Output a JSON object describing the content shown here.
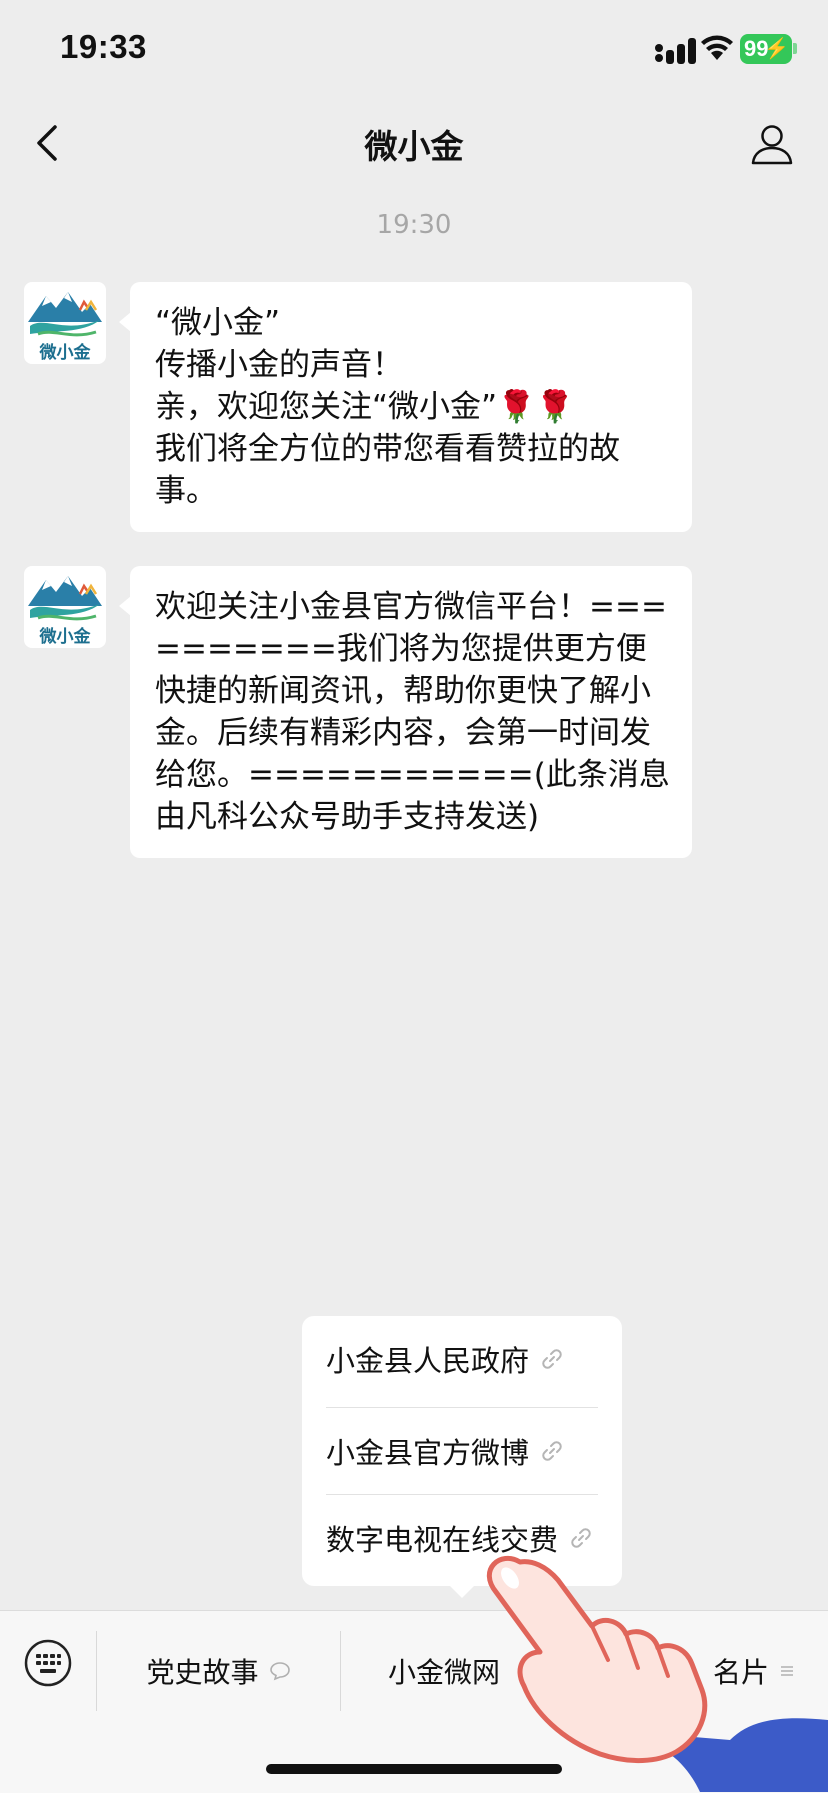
{
  "status_bar": {
    "time": "19:33",
    "battery": "99"
  },
  "nav": {
    "title": "微小金"
  },
  "chat": {
    "timestamp": "19:30",
    "messages": [
      {
        "avatar_caption": "微小金",
        "text": "“微小金”\n传播小金的声音！\n亲，欢迎您关注“微小金”🌹🌹\n我们将全方位的带您看看赞拉的故事。"
      },
      {
        "avatar_caption": "微小金",
        "text": "欢迎关注小金县官方微信平台！==========我们将为您提供更方便快捷的新闻资讯，帮助你更快了解小金。后续有精彩内容，会第一时间发给您。===========(此条消息由凡科公众号助手支持发送)"
      }
    ]
  },
  "popup_menu": {
    "items": [
      {
        "label": "小金县人民政府",
        "icon": "link-icon"
      },
      {
        "label": "小金县官方微博",
        "icon": "link-icon"
      },
      {
        "label": "数字电视在线交费",
        "icon": "link-icon"
      }
    ]
  },
  "bottom_menu": {
    "keyboard_icon": "keyboard-icon",
    "items": [
      {
        "label": "党史故事",
        "icon": "chat-bubble-icon"
      },
      {
        "label": "小金微网",
        "icon": ""
      },
      {
        "label": "名片",
        "icon": "menu-lines-icon"
      }
    ]
  },
  "colors": {
    "background": "#ededed",
    "bubble": "#ffffff",
    "battery": "#34c759",
    "timestamp": "#a6a6a6"
  }
}
